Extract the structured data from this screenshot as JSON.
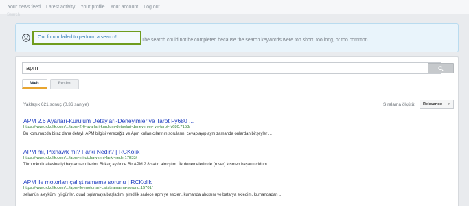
{
  "nav": {
    "items": [
      "Your news feed",
      "Latest activity",
      "Your profile",
      "Your account",
      "Log out"
    ],
    "faded": "Search"
  },
  "notice": {
    "title": "Our forum failed to perform a search!",
    "message": "The search could not be completed because the search keywords were too short, too long, or too common."
  },
  "search": {
    "query": "apm",
    "clear_glyph": "×",
    "button_glyph": "🔍"
  },
  "tabs": [
    "Web",
    "Resim"
  ],
  "results_info": {
    "count": "Yaklaşık 621 sonuç (0,36 saniye)",
    "sort_label": "Sıralama ölçütü:",
    "sort_value": "Relevance"
  },
  "results": [
    {
      "title": "APM 2.6 Ayarları-Kurulum Detayları-Deneyimler ve Tarot Fy680 ...",
      "url": "https://www.rckolik.com/.../apm-2-6-ayarlari-kurulum-detaylari-deneyimler- ve-tarot-fy680.7153/",
      "snippet": "Bu konumuzda biraz daha detaylı APM bilgisi vereceğiz ve Apm kullanıcılarının sorularını cevaplayıp aynı zamanda onlardan birşeyler ..."
    },
    {
      "title": "APM mi, Pixhawk mı? Farkı Nedir? | RCKolik",
      "url": "https://www.rckolik.com/.../apm-mi-pixhawk-mi-farki-nedir.17833/",
      "snippet": "Tüm rckolik ailesine iyi bayramlar dilerim. Birkaç ay önce Bir APM 2.8 satın almıştım. İlk denemelerimde (rover) kısmen başarılı oldum."
    },
    {
      "title": "APM ile motorları çalıştıramama sorunu | RCKolik",
      "url": "https://www.rckolik.com/.../apm-ile-motorlari-calistiramama-sorunu.15701/",
      "snippet": "selamün aleyküm. iyi günler. quad toplamaya başladım. şimdilik sadece apm ye escleri, kumanda alıcısını ve batarya ekledim. kumandadan ..."
    }
  ]
}
